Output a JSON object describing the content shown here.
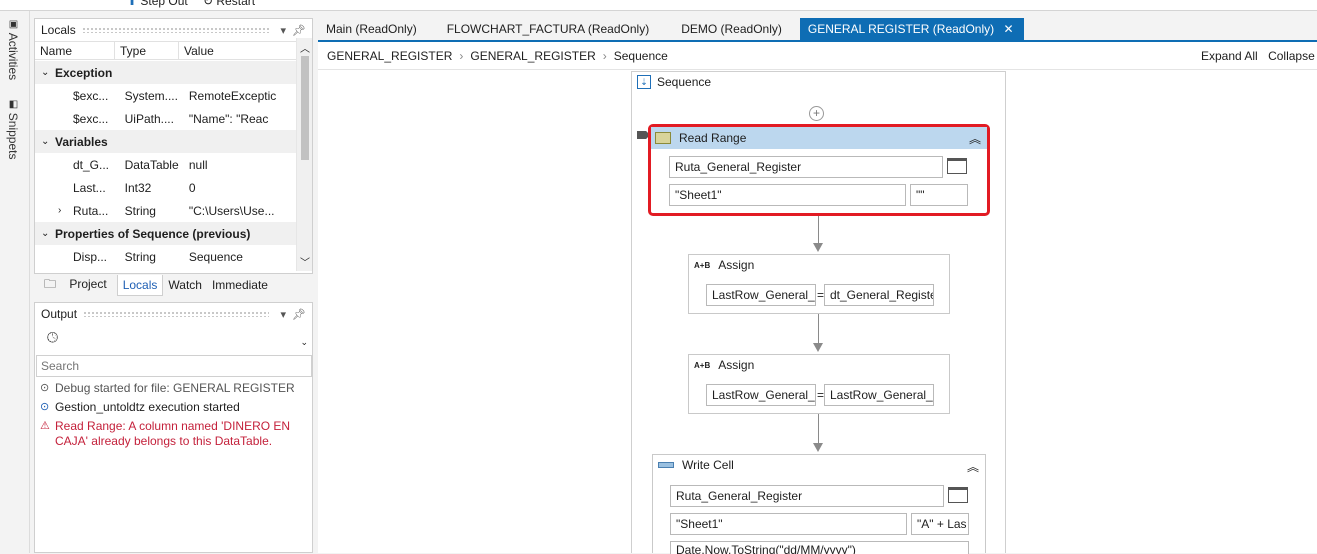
{
  "top_toolbar": {
    "step_out": "Step Out",
    "restart": "Restart"
  },
  "side_tabs": {
    "activities": "Activities",
    "snippets": "Snippets"
  },
  "locals": {
    "title": "Locals",
    "columns": {
      "name": "Name",
      "type": "Type",
      "value": "Value"
    },
    "groups": {
      "exception": "Exception",
      "variables": "Variables",
      "properties": "Properties of Sequence (previous)"
    },
    "exception_rows": [
      {
        "name": "$exc...",
        "type": "System....",
        "value": "RemoteExceptic"
      },
      {
        "name": "$exc...",
        "type": "UiPath....",
        "value": "\"Name\": \"Reac"
      }
    ],
    "variable_rows": [
      {
        "name": "dt_G...",
        "type": "DataTable",
        "value": "null"
      },
      {
        "name": "Last...",
        "type": "Int32",
        "value": "0"
      },
      {
        "name": "Ruta...",
        "type": "String",
        "value": "\"C:\\Users\\Use..."
      }
    ],
    "property_rows": [
      {
        "name": "Disp...",
        "type": "String",
        "value": "Sequence"
      }
    ]
  },
  "bottom_tabs": {
    "project": "Project",
    "locals": "Locals",
    "watch": "Watch",
    "immediate": "Immediate"
  },
  "output": {
    "title": "Output",
    "search_placeholder": "Search",
    "lines": [
      {
        "icon": "info-circle",
        "text": "Debug started for file: GENERAL REGISTER",
        "color": "#555555"
      },
      {
        "icon": "info-circle",
        "text": "Gestion_untoldtz execution started",
        "color": "#1e1e1e"
      },
      {
        "icon": "warning-triangle",
        "text": "Read Range: A column named 'DINERO EN CAJA' already belongs to this DataTable.",
        "color": "#c4213b"
      }
    ]
  },
  "doc_tabs": {
    "main": "Main (ReadOnly)",
    "flowchart": "FLOWCHART_FACTURA (ReadOnly)",
    "demo": "DEMO (ReadOnly)",
    "general": "GENERAL REGISTER (ReadOnly)"
  },
  "breadcrumb": {
    "b1": "GENERAL_REGISTER",
    "b2": "GENERAL_REGISTER",
    "b3": "Sequence"
  },
  "canvas_actions": {
    "expand_all": "Expand All",
    "collapse_all": "Collapse All"
  },
  "sequence": {
    "title": "Sequence"
  },
  "read_range": {
    "title": "Read Range",
    "path": "Ruta_General_Register",
    "sheet": "\"Sheet1\"",
    "range": "\"\""
  },
  "assign1": {
    "title": "Assign",
    "to": "LastRow_General_R",
    "value": "dt_General_Registe"
  },
  "assign2": {
    "title": "Assign",
    "to": "LastRow_General_R",
    "value": "LastRow_General_R"
  },
  "write_cell": {
    "title": "Write Cell",
    "path": "Ruta_General_Register",
    "sheet": "\"Sheet1\"",
    "cell": "\"A\" + Las",
    "value": "Date.Now.ToString(\"dd/MM/yyyy\")"
  },
  "colors": {
    "accent": "#0e6db4",
    "highlight": "#e21b23",
    "selected_header": "#bcd7ee"
  }
}
